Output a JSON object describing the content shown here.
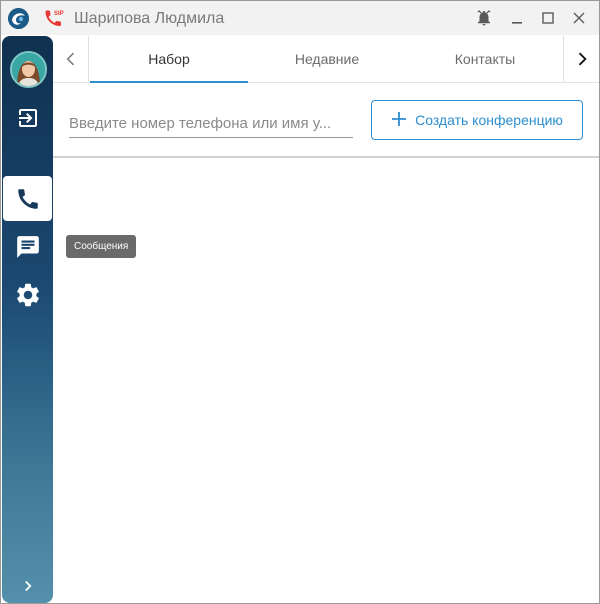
{
  "window": {
    "title": "Шарипова Людмила",
    "sip_badge": "SIP"
  },
  "tabs": [
    {
      "label": "Набор",
      "active": true
    },
    {
      "label": "Недавние",
      "active": false
    },
    {
      "label": "Контакты",
      "active": false
    }
  ],
  "dial": {
    "placeholder": "Введите номер телефона или имя у...",
    "create_conference_label": "Создать конференцию"
  },
  "sidebar": {
    "tooltip": "Сообщения",
    "items": [
      "logout-icon",
      "phone-icon",
      "message-icon",
      "gear-icon",
      "chevron-right-icon"
    ]
  },
  "colors": {
    "accent": "#2c8fd0",
    "sip_red": "#e53935",
    "sidebar_top": "#10314f",
    "sidebar_bottom": "#5490ab"
  }
}
